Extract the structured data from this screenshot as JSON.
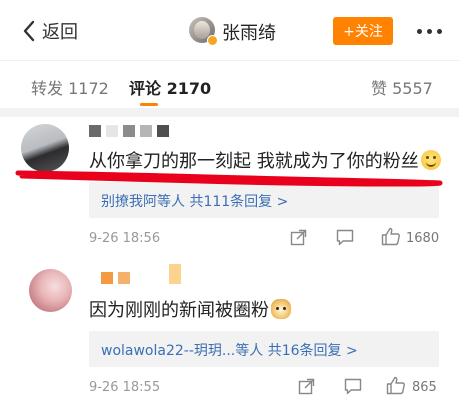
{
  "header": {
    "back_label": "返回",
    "username": "张雨绮",
    "follow_label": "+关注"
  },
  "tabs": [
    {
      "label": "转发",
      "count": "1172",
      "active": false
    },
    {
      "label": "评论",
      "count": "2170",
      "active": true
    },
    {
      "label": "赞",
      "count": "5557",
      "active": false
    }
  ],
  "colors": {
    "accent": "#ff8200",
    "link": "#3b6fb5",
    "highlight_stroke": "#e8001c"
  },
  "comments": [
    {
      "text": "从你拿刀的那一刻起 我就成为了你的粉丝",
      "emoji": "smile-emoji",
      "reply_users": "别撩我阿等人",
      "reply_count_label": "共111条回复 >",
      "timestamp": "9-26 18:56",
      "likes": "1680"
    },
    {
      "text": "因为刚刚的新闻被圈粉",
      "emoji": "doge-emoji",
      "reply_users": "wolawola22--玥玥...等人",
      "reply_count_label": "共16条回复 >",
      "timestamp": "9-26 18:55",
      "likes": "865"
    }
  ]
}
